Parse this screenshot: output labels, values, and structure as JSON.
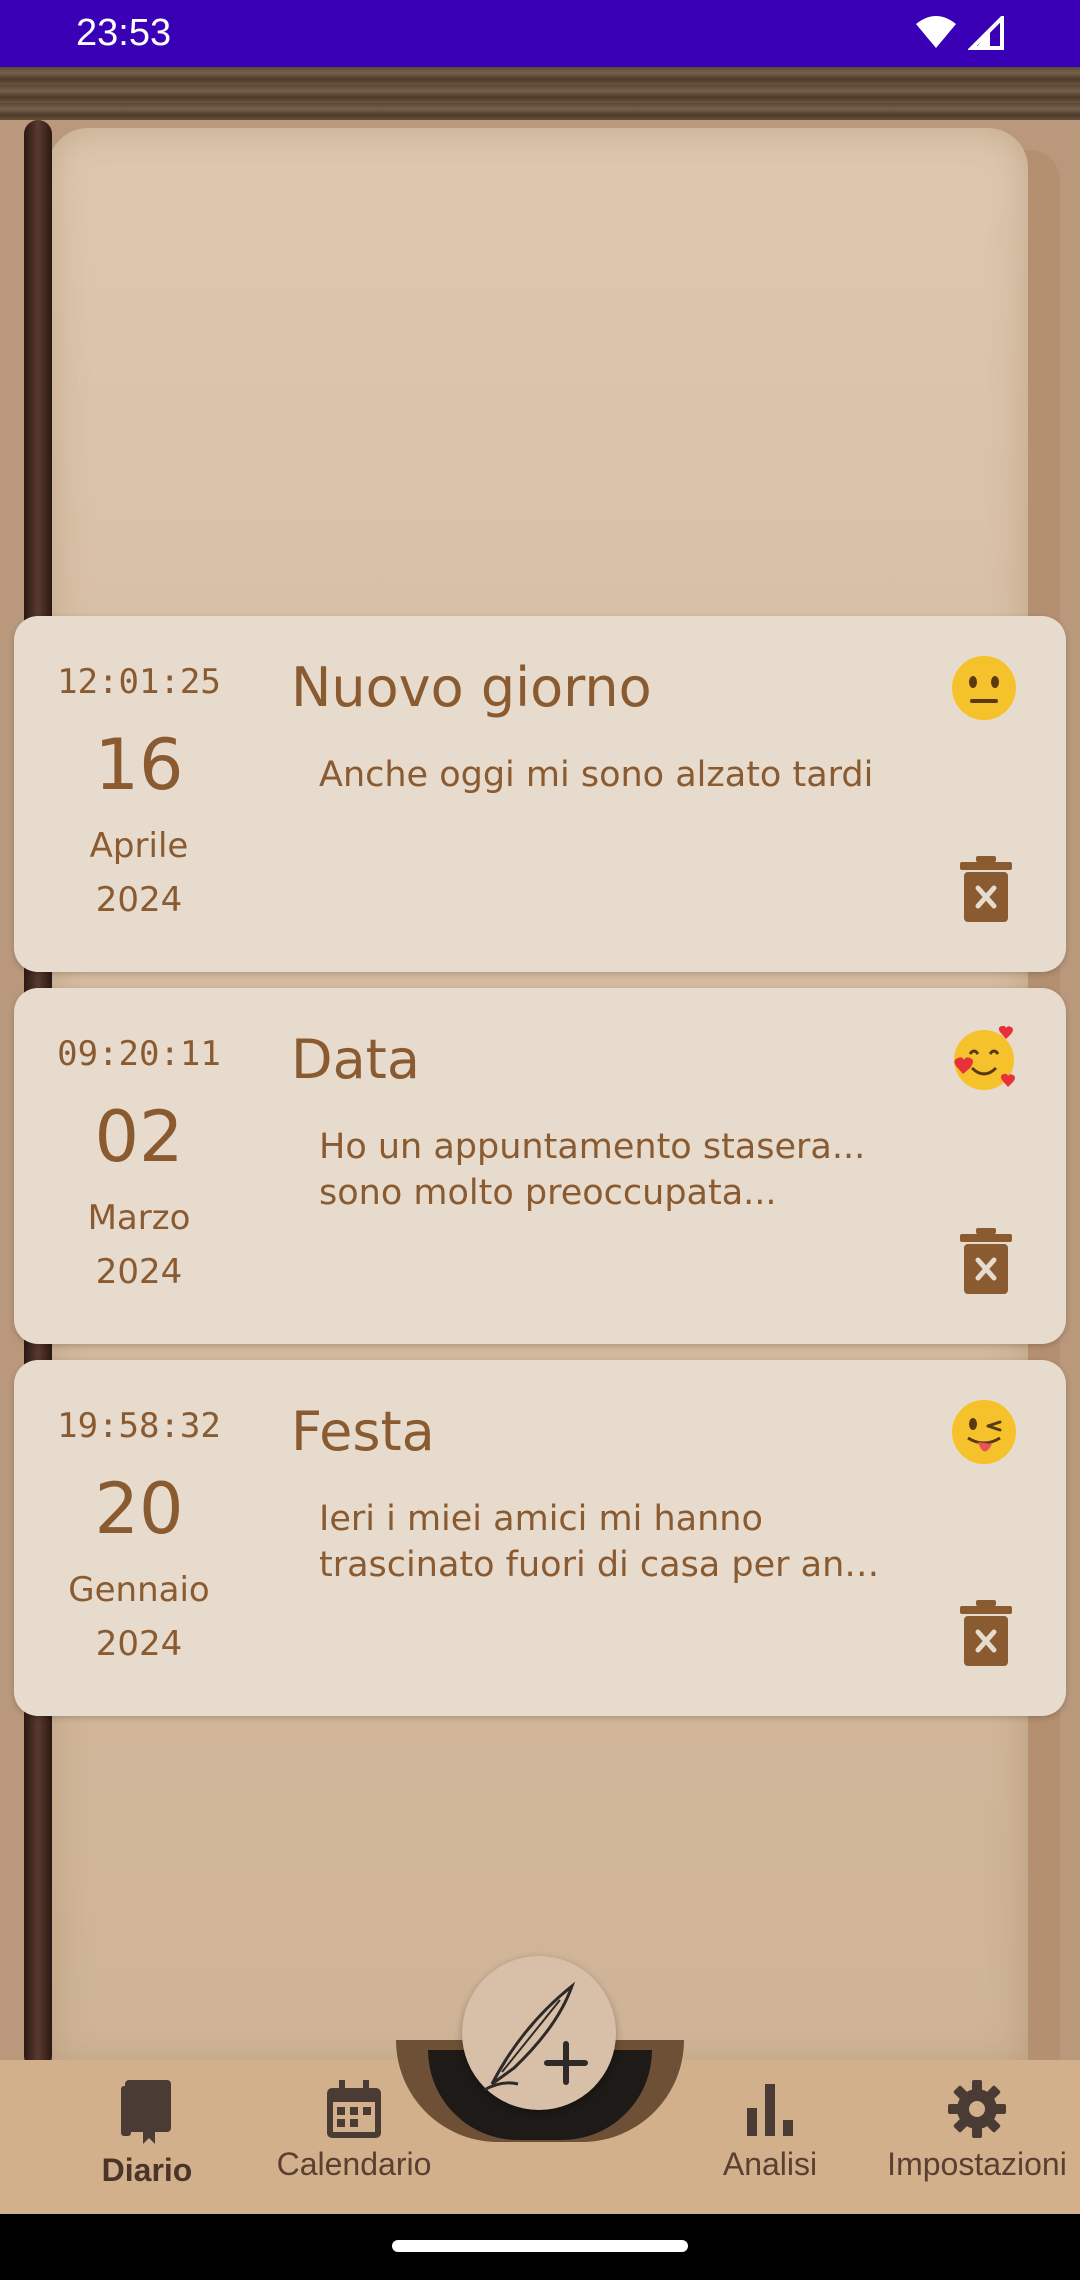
{
  "status_bar": {
    "time": "23:53"
  },
  "entries": [
    {
      "time": "12:01:25",
      "day": "16",
      "month": "Aprile",
      "year": "2024",
      "title": "Nuovo giorno",
      "body": "Anche oggi mi sono alzato tardi",
      "mood": "neutral-face-emoji"
    },
    {
      "time": "09:20:11",
      "day": "02",
      "month": "Marzo",
      "year": "2024",
      "title": "Data",
      "body_line1": "Ho un appuntamento stasera...",
      "body_line2": "sono molto preoccupata...",
      "mood": "smiling-face-with-hearts-emoji"
    },
    {
      "time": "19:58:32",
      "day": "20",
      "month": "Gennaio",
      "year": "2024",
      "title": "Festa",
      "body_line1": "Ieri i miei amici mi hanno",
      "body_line2": "trascinato fuori di casa per an…",
      "mood": "winking-face-with-tongue-emoji"
    }
  ],
  "bottom_nav": {
    "items": [
      {
        "label": "Diario",
        "icon": "book-icon",
        "active": true
      },
      {
        "label": "Calendario",
        "icon": "calendar-icon",
        "active": false
      },
      {
        "label": "Analisi",
        "icon": "bar-chart-icon",
        "active": false
      },
      {
        "label": "Impostazioni",
        "icon": "gear-icon",
        "active": false
      }
    ]
  },
  "fab": {
    "icon": "quill-plus-icon"
  },
  "colors": {
    "status_bar": "#3a00b6",
    "card_bg": "#e6dbcd",
    "text_brown": "#8a5a30",
    "nav_bg": "#d2b08b"
  }
}
